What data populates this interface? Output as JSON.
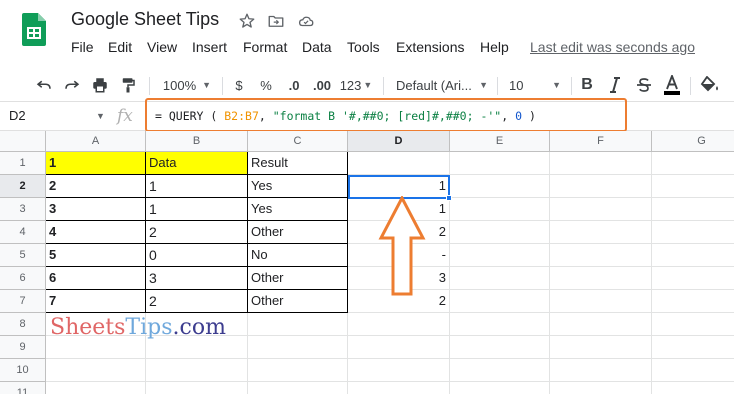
{
  "app": {
    "doc_title": "Google Sheet Tips",
    "last_edit": "Last edit was seconds ago",
    "brand_color": "#0f9d58"
  },
  "menu": [
    "File",
    "Edit",
    "View",
    "Insert",
    "Format",
    "Data",
    "Tools",
    "Extensions",
    "Help"
  ],
  "toolbar": {
    "zoom": "100%",
    "currency": "$",
    "percent": "%",
    "dec_decrease": ".0",
    "dec_increase": ".00",
    "more_formats": "123",
    "font": "Default (Ari...",
    "font_size": "10",
    "bold": "B"
  },
  "formula_bar": {
    "name_box": "D2",
    "fx": "fx",
    "formula_parts": {
      "p1": "= QUERY ( ",
      "p2": "B2:B7",
      "p3": ", ",
      "p4": "\"format B '#,##0; [red]#,##0; -'\"",
      "p5": ", ",
      "p6": "0",
      "p7": " )"
    },
    "highlight_color": "#ed7d31"
  },
  "grid": {
    "columns": [
      "A",
      "B",
      "C",
      "D",
      "E",
      "F",
      "G"
    ],
    "rows": [
      "1",
      "2",
      "3",
      "4",
      "5",
      "6",
      "7",
      "8",
      "9",
      "10",
      "11"
    ],
    "cells": {
      "A": [
        "1",
        "2",
        "3",
        "4",
        "5",
        "6",
        "7"
      ],
      "B": [
        "Data",
        "1",
        "1",
        "2",
        "0",
        "3",
        "2"
      ],
      "C": [
        "Result",
        "Yes",
        "Yes",
        "Other",
        "No",
        "Other",
        "Other"
      ],
      "D": [
        "",
        "1",
        "1",
        "2",
        "-",
        "3",
        "2"
      ]
    },
    "selected_cell": "D2",
    "header_fill": "#ffff00"
  },
  "watermark": {
    "part1": "Sheets",
    "part2": "Tips",
    "part3": ".com"
  },
  "annotation": {
    "arrow_color": "#ed7d31"
  }
}
